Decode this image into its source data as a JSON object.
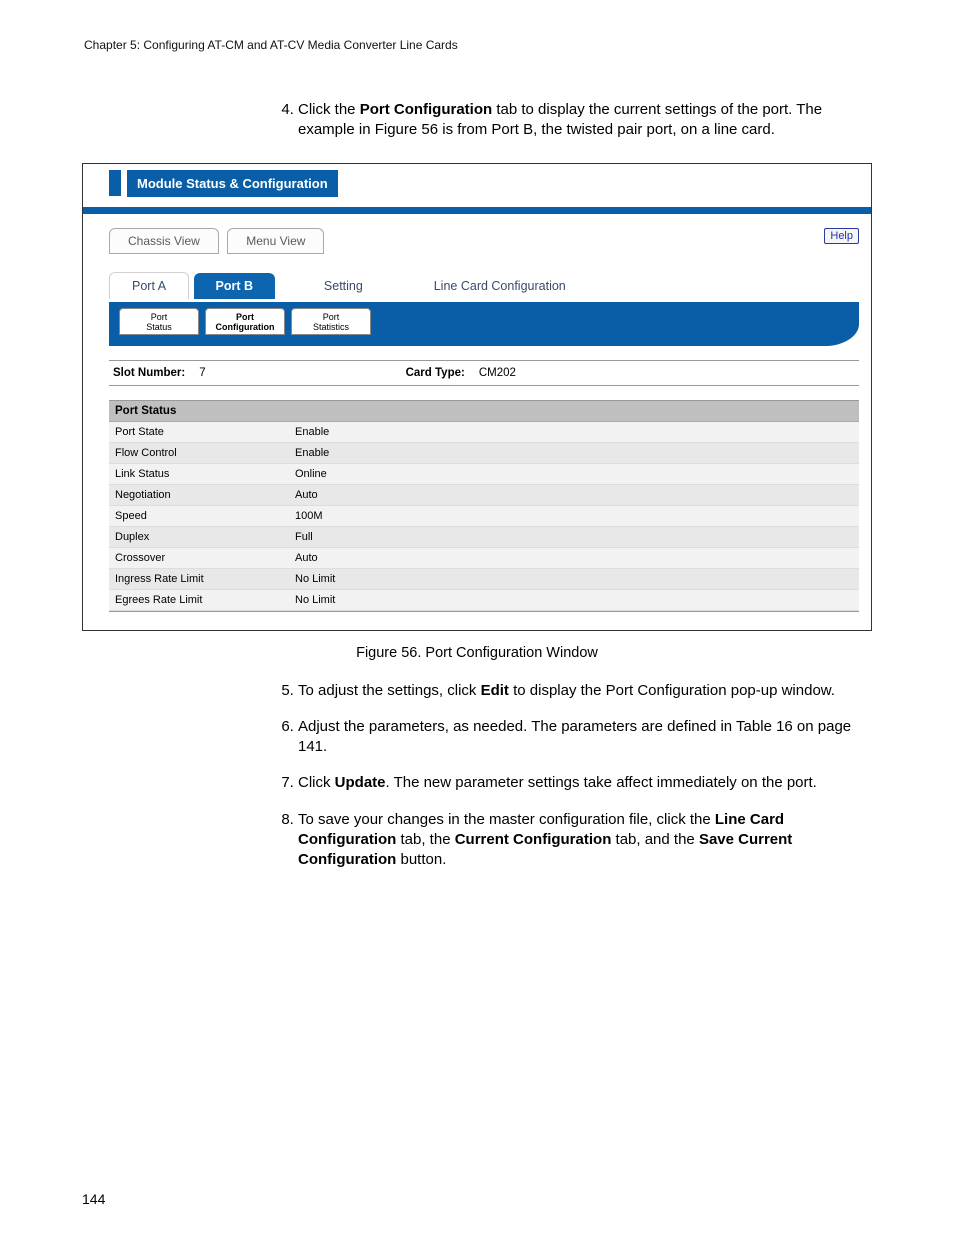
{
  "chapter_header": "Chapter 5: Configuring AT-CM and AT-CV Media Converter Line Cards",
  "steps": {
    "s4_pre": "Click the ",
    "s4_b1": "Port Configuration",
    "s4_post": " tab to display the current settings of the port. The example in Figure 56 is from Port B, the twisted pair port, on a line card.",
    "s5_pre": "To adjust the settings, click ",
    "s5_b1": "Edit",
    "s5_post": " to display the Port Configuration pop-up window.",
    "s6": "Adjust the parameters, as needed. The parameters are defined in Table 16 on page 141.",
    "s7_pre": "Click ",
    "s7_b1": "Update",
    "s7_post": ". The new parameter settings take affect immediately on the port.",
    "s8_pre": "To save your changes in the master configuration file, click the ",
    "s8_b1": "Line Card Configuration",
    "s8_mid1": " tab, the ",
    "s8_b2": "Current Configuration",
    "s8_mid2": " tab, and the ",
    "s8_b3": "Save Current Configuration",
    "s8_post": " button."
  },
  "figure": {
    "caption": "Figure 56. Port Configuration Window",
    "window_title": "Module Status & Configuration",
    "help": "Help",
    "view_tabs": {
      "chassis": "Chassis View",
      "menu": "Menu View"
    },
    "port_tabs": {
      "a": "Port A",
      "b": "Port B",
      "setting": "Setting",
      "lcc": "Line Card Configuration"
    },
    "sub_tabs": {
      "status": {
        "l1": "Port",
        "l2": "Status"
      },
      "config": {
        "l1": "Port",
        "l2": "Configuration"
      },
      "stats": {
        "l1": "Port",
        "l2": "Statistics"
      }
    },
    "info": {
      "slot_lbl": "Slot Number:",
      "slot_val": "7",
      "card_lbl": "Card Type:",
      "card_val": "CM202"
    },
    "status_header": "Port Status",
    "rows": [
      {
        "k": "Port State",
        "v": "Enable"
      },
      {
        "k": "Flow Control",
        "v": "Enable"
      },
      {
        "k": "Link Status",
        "v": "Online"
      },
      {
        "k": "Negotiation",
        "v": "Auto"
      },
      {
        "k": "Speed",
        "v": "100M"
      },
      {
        "k": "Duplex",
        "v": "Full"
      },
      {
        "k": "Crossover",
        "v": "Auto"
      },
      {
        "k": "Ingress Rate Limit",
        "v": "No Limit"
      },
      {
        "k": "Egrees Rate Limit",
        "v": "No Limit"
      }
    ]
  },
  "page_number": "144"
}
